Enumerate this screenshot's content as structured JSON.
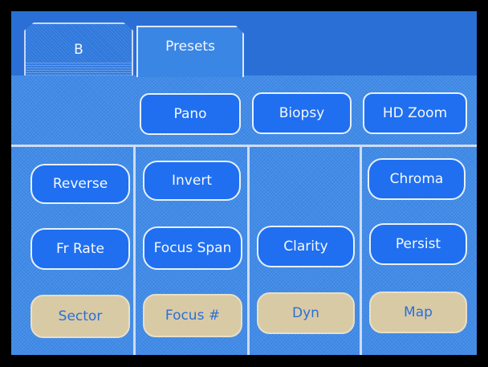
{
  "tabs": [
    {
      "label": "B",
      "active": false
    },
    {
      "label": "Presets",
      "active": true
    }
  ],
  "presets_row": [
    "Pano",
    "Biopsy",
    "HD Zoom"
  ],
  "columns": {
    "col1": {
      "top": "Reverse",
      "mid": "Fr Rate",
      "bottom": "Sector"
    },
    "col2": {
      "top": "Invert",
      "mid": "Focus Span",
      "bottom": "Focus #"
    },
    "col3": {
      "mid": "Clarity",
      "bottom": "Dyn"
    },
    "col4": {
      "top": "Chroma",
      "mid": "Persist",
      "bottom": "Map"
    }
  },
  "colors": {
    "screen": "#3a86e4",
    "button": "#1f6ff0",
    "accent_tan": "#d9caa6"
  }
}
